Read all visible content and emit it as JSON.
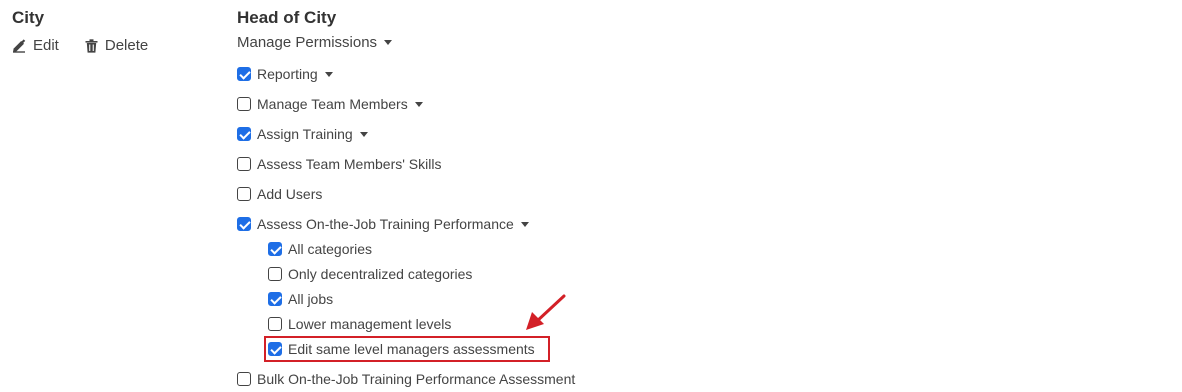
{
  "entity": {
    "title": "City",
    "edit_label": "Edit",
    "delete_label": "Delete"
  },
  "role": {
    "title": "Head of City",
    "manage_permissions_label": "Manage Permissions"
  },
  "permissions": [
    {
      "label": "Reporting",
      "checked": true,
      "dropdown": true
    },
    {
      "label": "Manage Team Members",
      "checked": false,
      "dropdown": true
    },
    {
      "label": "Assign Training",
      "checked": true,
      "dropdown": true
    },
    {
      "label": "Assess Team Members' Skills",
      "checked": false,
      "dropdown": false
    },
    {
      "label": "Add Users",
      "checked": false,
      "dropdown": false
    },
    {
      "label": "Assess On-the-Job Training Performance",
      "checked": true,
      "dropdown": true,
      "children": [
        {
          "label": "All categories",
          "checked": true
        },
        {
          "label": "Only decentralized categories",
          "checked": false
        },
        {
          "label": "All jobs",
          "checked": true
        },
        {
          "label": "Lower management levels",
          "checked": false
        },
        {
          "label": "Edit same level managers assessments",
          "checked": true,
          "highlighted": true
        }
      ]
    },
    {
      "label": "Bulk On-the-Job Training Performance Assessment",
      "checked": false,
      "dropdown": false
    }
  ],
  "colors": {
    "checkbox_checked": "#1e6ee6",
    "highlight": "#d32027"
  }
}
